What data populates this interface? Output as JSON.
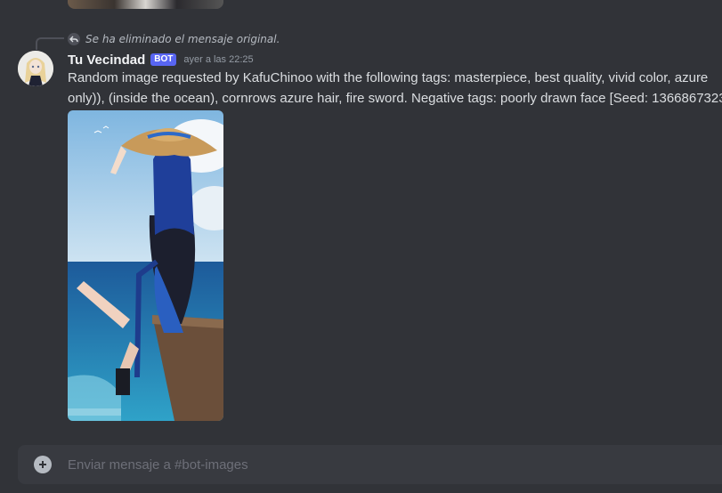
{
  "previous_message": {
    "image": "anime-illustration"
  },
  "reply": {
    "text": "Se ha eliminado el mensaje original.",
    "icon": "reply-arrow-icon"
  },
  "message": {
    "author": "Tu Vecindad",
    "badge": "BOT",
    "timestamp": "ayer a las 22:25",
    "text_line_1": "Random image requested by KafuChinoo with the following tags: masterpiece, best quality, vivid color, azure",
    "text_line_2": "only)), (inside the ocean), cornrows azure hair, fire sword. Negative tags: poorly drawn face [Seed: 1366867323",
    "attachment": "anime-girl-straw-hat-ocean-image"
  },
  "composer": {
    "placeholder": "Enviar mensaje a #bot-images",
    "value": ""
  },
  "colors": {
    "background": "#313338",
    "badge": "#5865f2",
    "composer": "#383a40"
  }
}
